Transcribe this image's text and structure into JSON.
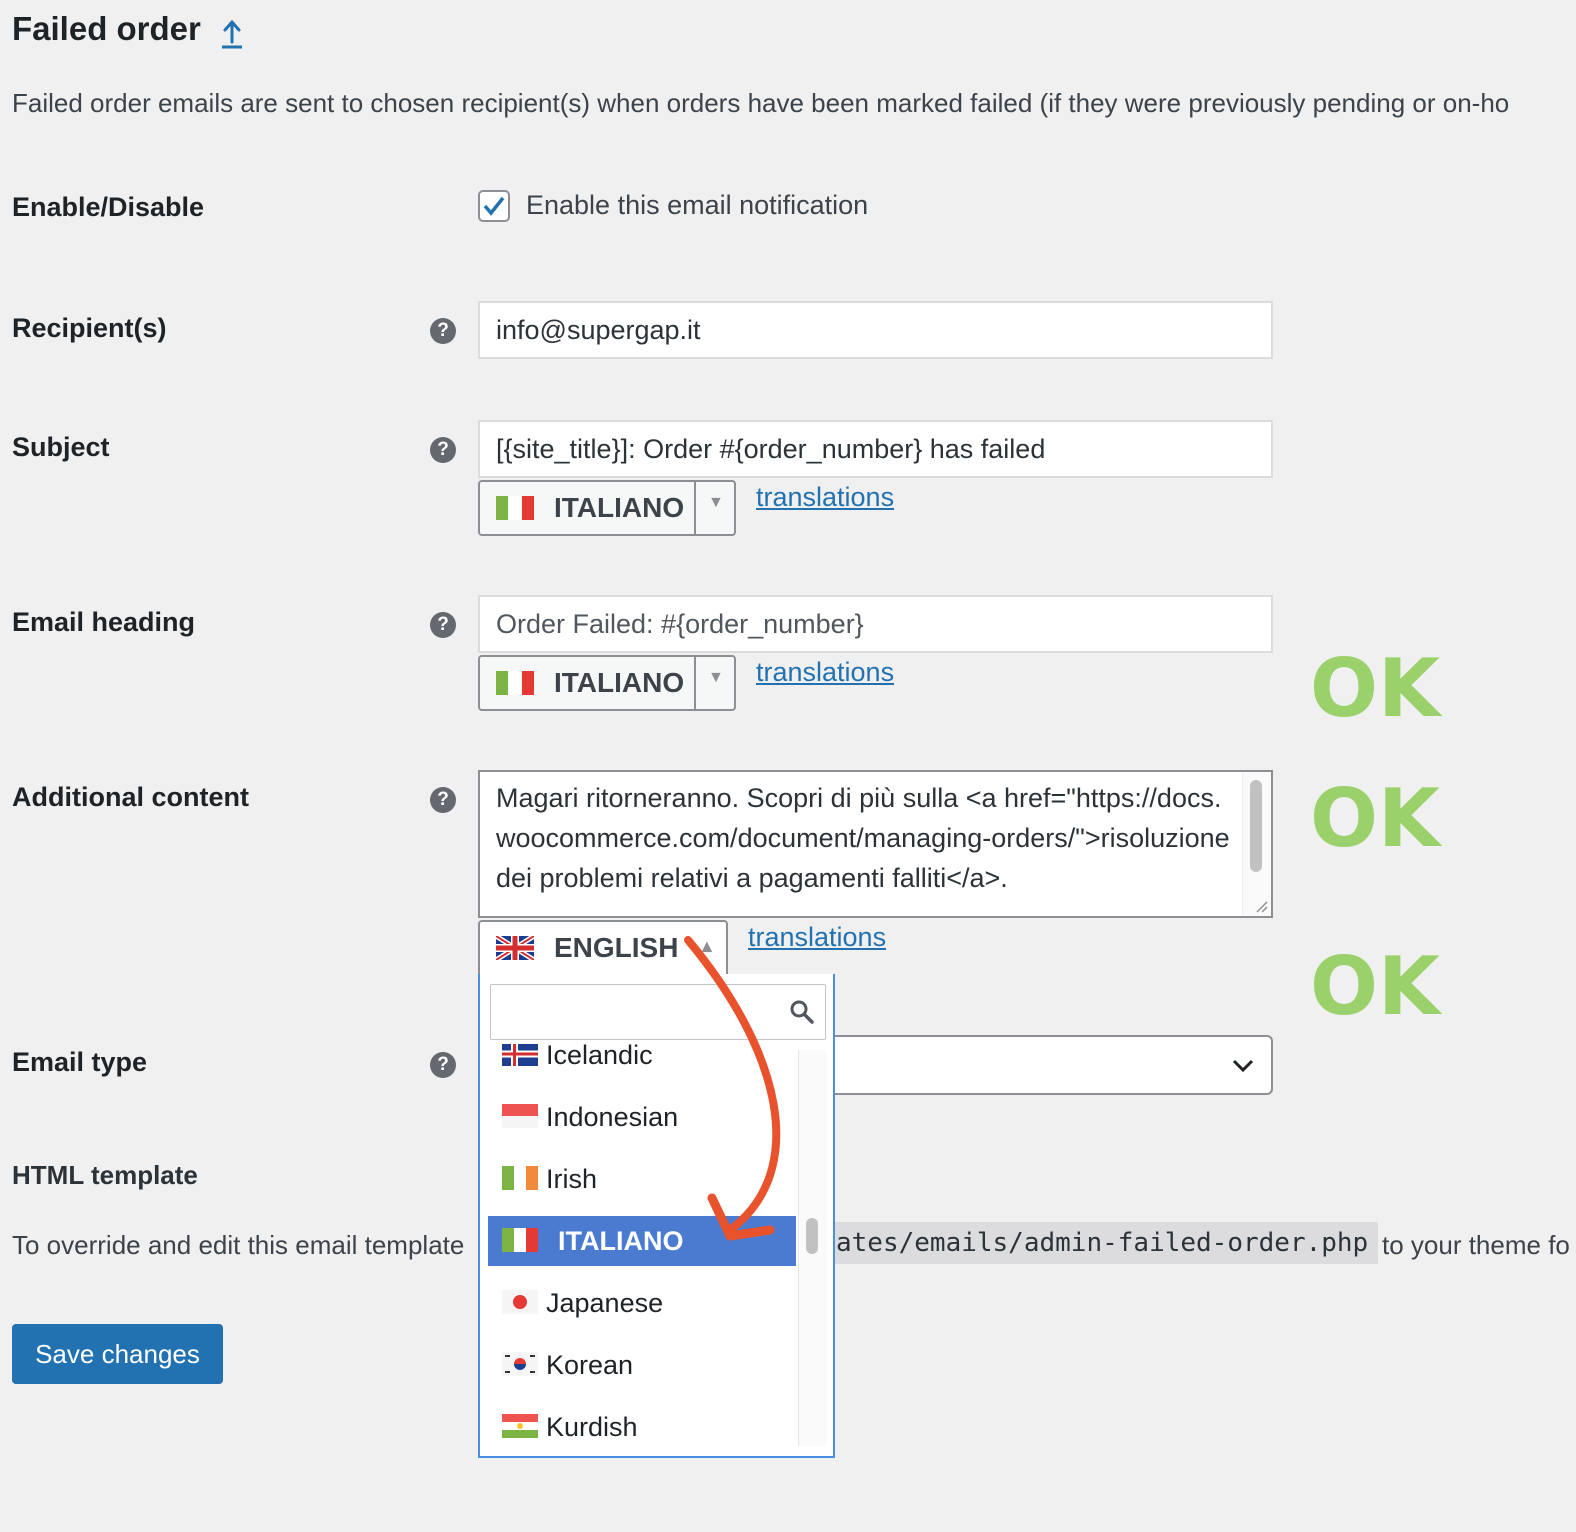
{
  "header": {
    "title": "Failed order",
    "description": "Failed order emails are sent to chosen recipient(s) when orders have been marked failed (if they were previously pending or on-ho"
  },
  "fields": {
    "enable": {
      "label": "Enable/Disable",
      "checkbox_label": "Enable this email notification",
      "checked": true
    },
    "recipient": {
      "label": "Recipient(s)",
      "help": "?",
      "value": "info@supergap.it"
    },
    "subject": {
      "label": "Subject",
      "help": "?",
      "value": "[{site_title}]: Order #{order_number} has failed",
      "language": "ITALIANO",
      "translations_link": "translations"
    },
    "heading": {
      "label": "Email heading",
      "help": "?",
      "placeholder": "Order Failed: #{order_number}",
      "language": "ITALIANO",
      "translations_link": "translations"
    },
    "additional": {
      "label": "Additional content",
      "help": "?",
      "value": "Magari ritorneranno. Scopri di più sulla <a href=\"https://docs.woocommerce.com/document/managing-orders/\">risoluzione dei problemi relativi a pagamenti falliti</a>.",
      "language": "ENGLISH",
      "translations_link": "translations"
    },
    "email_type": {
      "label": "Email type",
      "help": "?"
    }
  },
  "annotations": {
    "ok1": "OK",
    "ok2": "OK",
    "ok3": "OK"
  },
  "language_dropdown": {
    "search_value": "",
    "options": [
      {
        "label": "Icelandic",
        "flag": "is"
      },
      {
        "label": "Indonesian",
        "flag": "id"
      },
      {
        "label": "Irish",
        "flag": "ie"
      },
      {
        "label": "ITALIANO",
        "flag": "it",
        "selected": true
      },
      {
        "label": "Japanese",
        "flag": "jp"
      },
      {
        "label": "Korean",
        "flag": "kr"
      },
      {
        "label": "Kurdish",
        "flag": "ku"
      }
    ]
  },
  "html_template": {
    "label": "HTML template",
    "override_text": "To override and edit this email template",
    "path": "ates/emails/admin-failed-order.php",
    "override_tail": "to your theme fo"
  },
  "save_button": "Save changes",
  "colors": {
    "accent": "#2271b1",
    "selected_option": "#4a7bd0",
    "ok_green": "#9bd16a",
    "arrow": "#e8532e"
  }
}
